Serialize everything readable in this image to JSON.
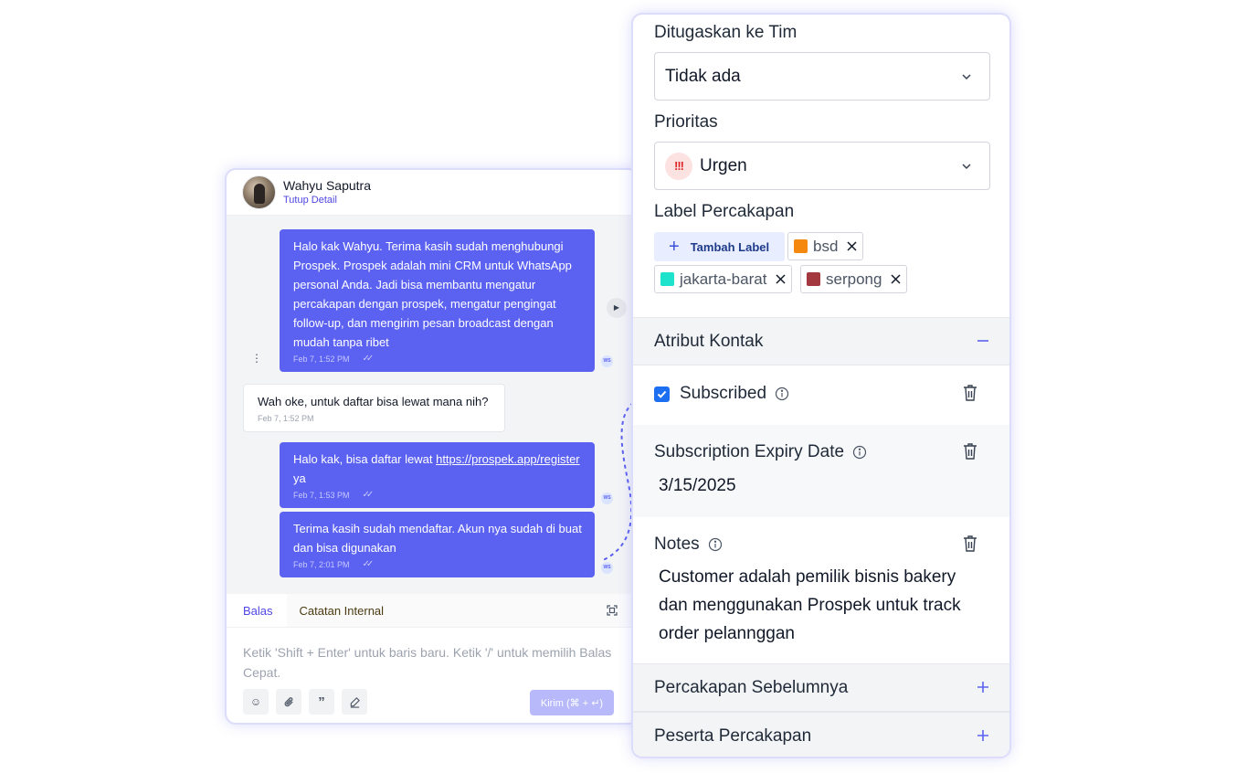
{
  "chat": {
    "contact_name": "Wahyu Saputra",
    "contact_action": "Tutup Detail",
    "messages": [
      {
        "text": "Halo kak Wahyu. Terima kasih sudah menghubungi Prospek. Prospek adalah mini CRM untuk WhatsApp personal Anda. Jadi bisa membantu mengatur percakapan dengan prospek, mengatur pengingat follow-up, dan mengirim pesan broadcast dengan mudah tanpa ribet",
        "time": "Feb 7, 1:52 PM"
      },
      {
        "text": "Wah oke, untuk daftar bisa lewat mana nih?",
        "time": "Feb 7, 1:52 PM"
      },
      {
        "text_before": "Halo kak, bisa daftar lewat",
        "link": "https://prospek.app/register",
        "text_after": "ya",
        "time": "Feb 7, 1:53 PM"
      },
      {
        "text": "Terima kasih sudah mendaftar. Akun nya sudah di buat dan bisa digunakan",
        "time": "Feb 7, 2:01 PM"
      }
    ],
    "sender_badge": "WS",
    "tabs": [
      "Balas",
      "Catatan Internal"
    ],
    "composer_placeholder": "Ketik 'Shift + Enter' untuk baris baru. Ketik '/' untuk memilih Balas Cepat.",
    "send_label": "Kirim (⌘ + ↵)",
    "tool_icons": [
      "smile-icon",
      "paperclip-icon",
      "quote-icon",
      "signature-icon"
    ]
  },
  "panel": {
    "team_label": "Ditugaskan ke Tim",
    "team_value": "Tidak ada",
    "priority_label": "Prioritas",
    "priority_value": "Urgen",
    "priority_icon": "!!!",
    "labels_title": "Label Percakapan",
    "add_label": "Tambah Label",
    "labels": [
      {
        "name": "bsd",
        "color": "#f5890f"
      },
      {
        "name": "jakarta-barat",
        "color": "#1de2cc"
      },
      {
        "name": "serpong",
        "color": "#a3383e"
      }
    ],
    "attributes_title": "Atribut Kontak",
    "attributes": [
      {
        "name": "Subscribed",
        "value": ""
      },
      {
        "name": "Subscription Expiry Date",
        "value": "3/15/2025"
      },
      {
        "name": "Notes",
        "value": "Customer adalah pemilik bisnis bakery dan menggunakan Prospek untuk track order pelannggan"
      }
    ],
    "previous_title": "Percakapan Sebelumnya",
    "participants_title": "Peserta Percakapan"
  }
}
